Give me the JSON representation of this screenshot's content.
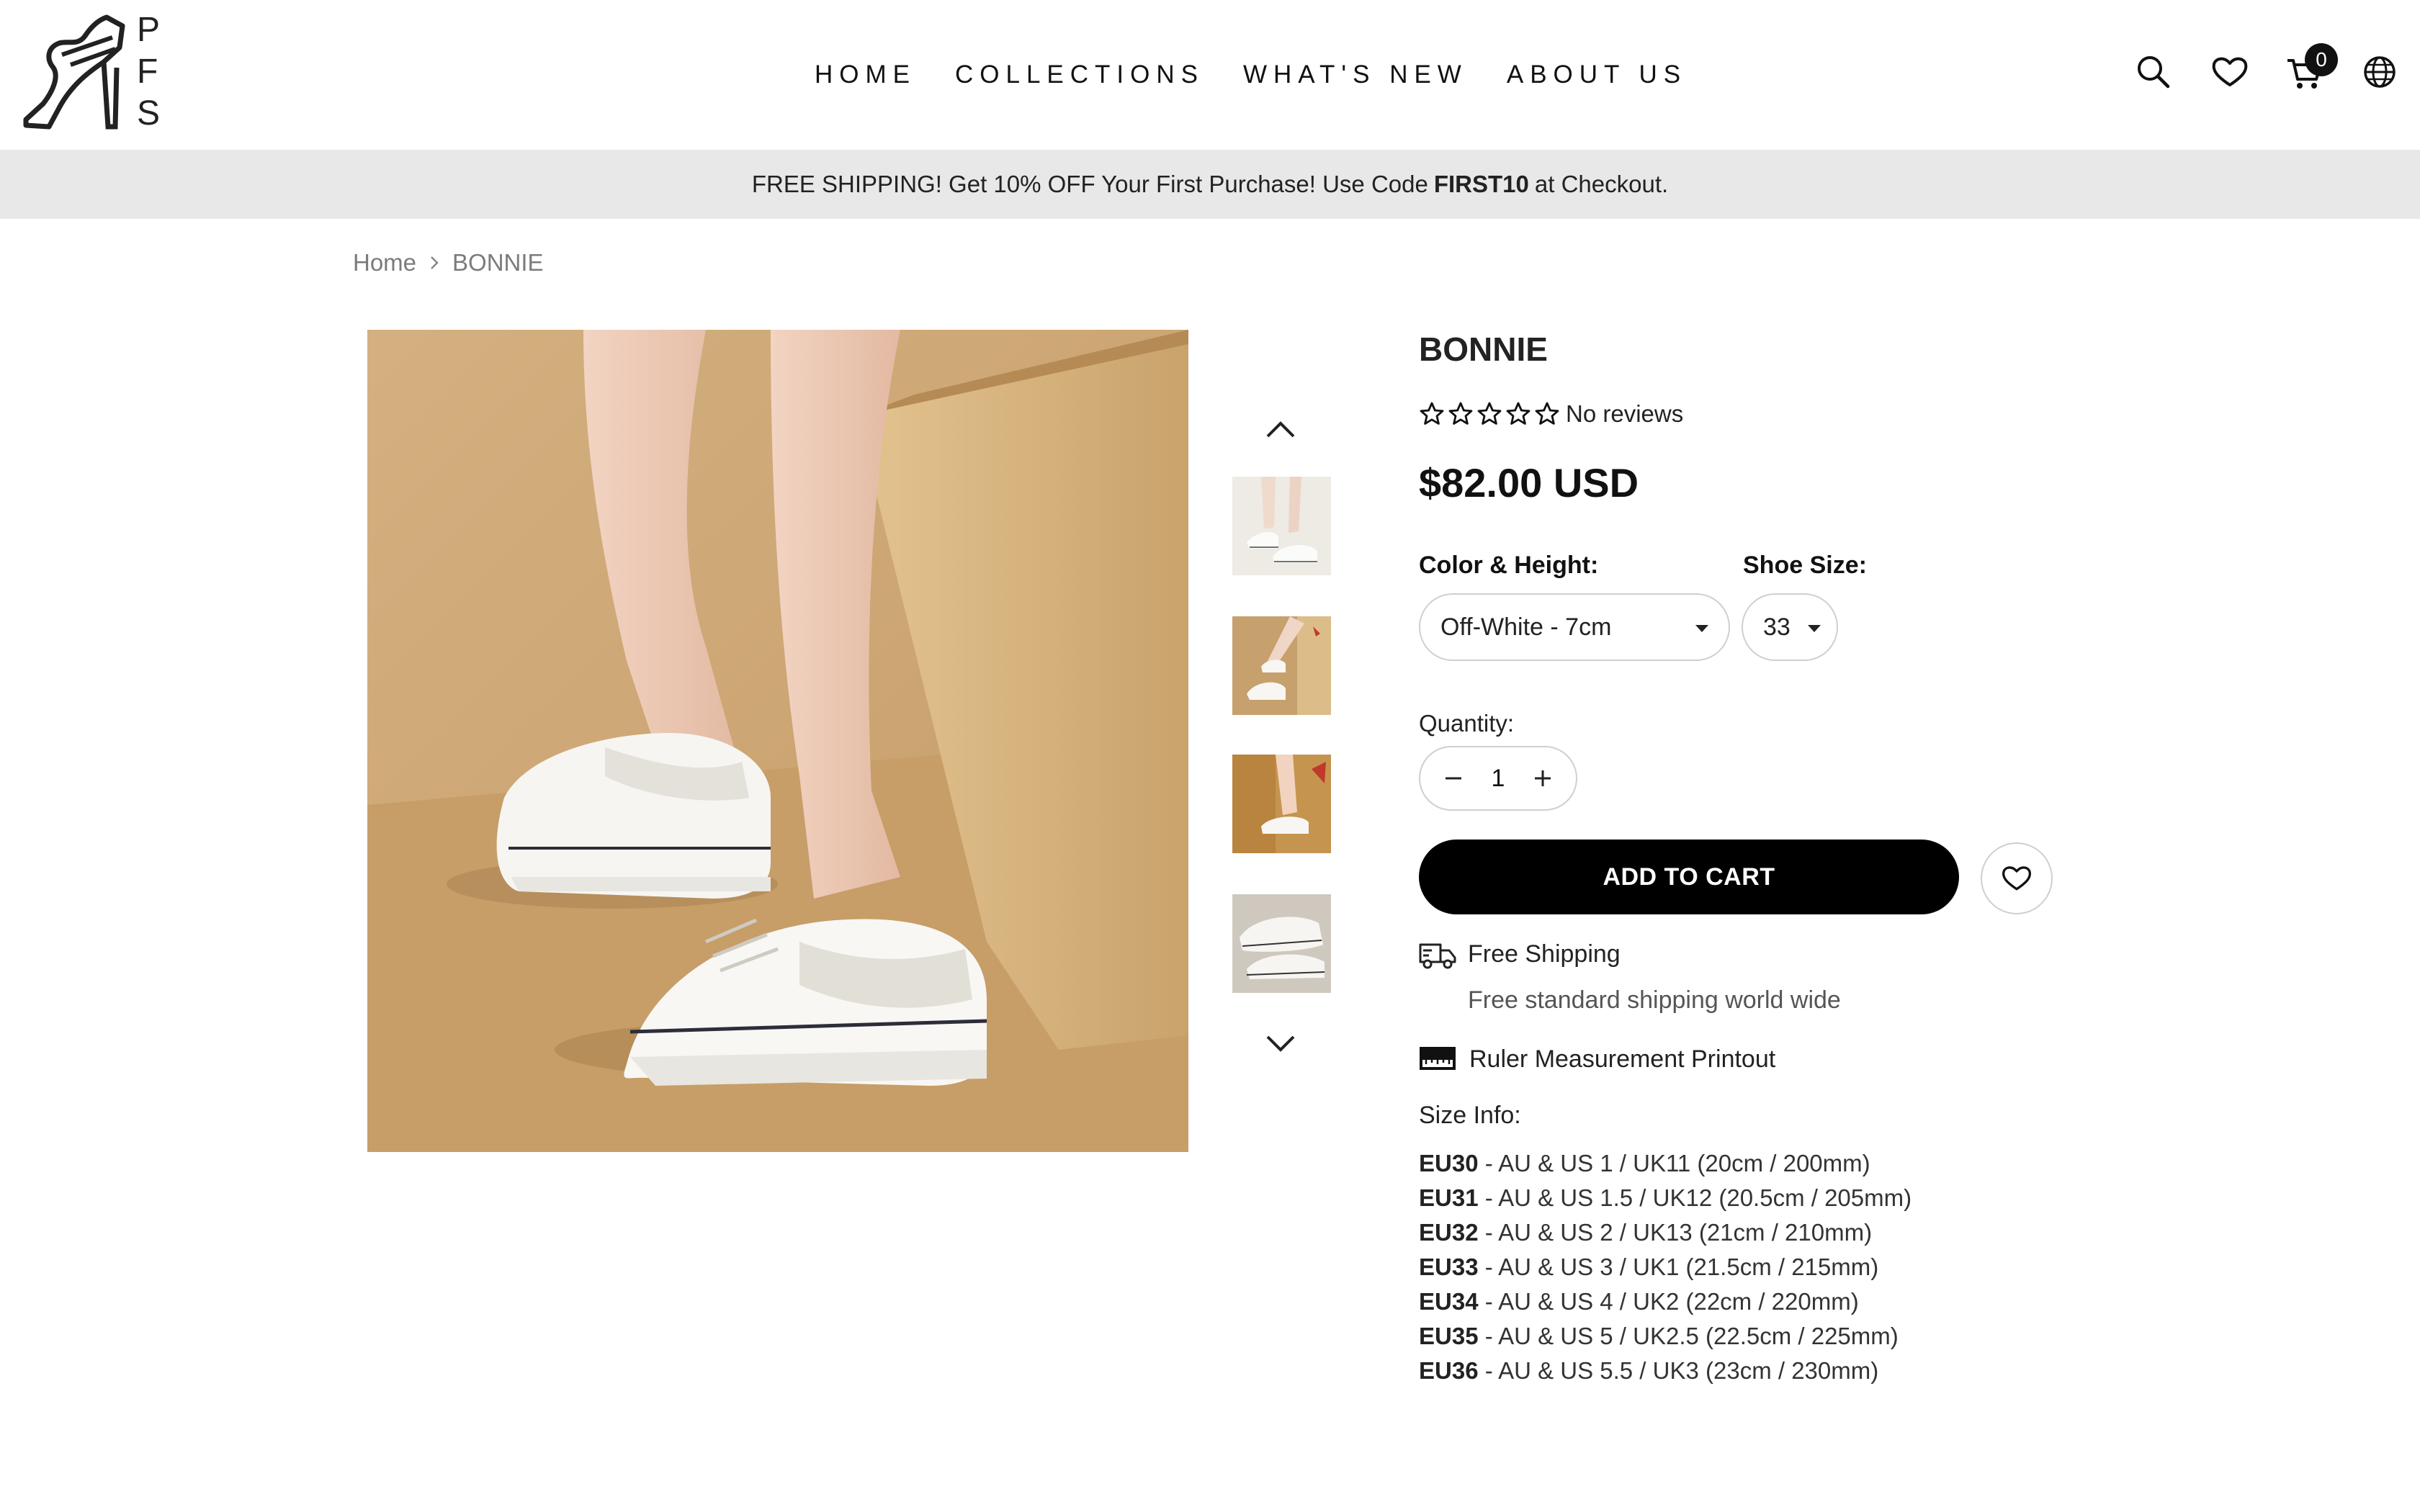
{
  "brand": {
    "logo_letters": [
      "P",
      "F",
      "S"
    ]
  },
  "nav": [
    {
      "label": "HOME"
    },
    {
      "label": "COLLECTIONS"
    },
    {
      "label": "WHAT'S NEW"
    },
    {
      "label": "ABOUT US"
    }
  ],
  "header": {
    "icons": [
      "search-icon",
      "heart-icon",
      "cart-icon",
      "globe-icon"
    ],
    "cart_count": "0"
  },
  "announcement": {
    "before": "FREE SHIPPING! Get 10% OFF Your First Purchase! Use Code",
    "code": "FIRST10",
    "after": "at Checkout."
  },
  "breadcrumb": {
    "home": "Home",
    "current": "BONNIE"
  },
  "product": {
    "title": "BONNIE",
    "rating_text": "No reviews",
    "rating_value": 0,
    "price": "$82.00 USD",
    "color_label": "Color & Height:",
    "color_value": "Off-White - 7cm",
    "size_label": "Shoe Size:",
    "size_value": "33",
    "quantity_label": "Quantity:",
    "quantity": "1",
    "add_to_cart": "ADD TO CART",
    "thumbnail_count": 4
  },
  "features": {
    "shipping_title": "Free Shipping",
    "shipping_sub": "Free standard shipping world wide",
    "ruler_title": "Ruler Measurement Printout"
  },
  "size_info": {
    "heading": "Size Info:",
    "rows": [
      {
        "eu": "EU30",
        "desc": " - AU & US 1 / UK11 (20cm / 200mm)"
      },
      {
        "eu": "EU31",
        "desc": " - AU & US 1.5 / UK12 (20.5cm / 205mm)"
      },
      {
        "eu": "EU32",
        "desc": " - AU & US 2 / UK13 (21cm / 210mm)"
      },
      {
        "eu": "EU33",
        "desc": " - AU & US 3 / UK1 (21.5cm / 215mm)"
      },
      {
        "eu": "EU34",
        "desc": " - AU & US 4 / UK2 (22cm / 220mm)"
      },
      {
        "eu": "EU35",
        "desc": " - AU & US 5 / UK2.5 (22.5cm / 225mm)"
      },
      {
        "eu": "EU36",
        "desc": " - AU & US 5.5 / UK3 (23cm / 230mm)"
      }
    ]
  },
  "colors": {
    "announcement_bg": "#e8e8e8",
    "button_bg": "#000000",
    "photo_backdrop": "#c8a272"
  }
}
